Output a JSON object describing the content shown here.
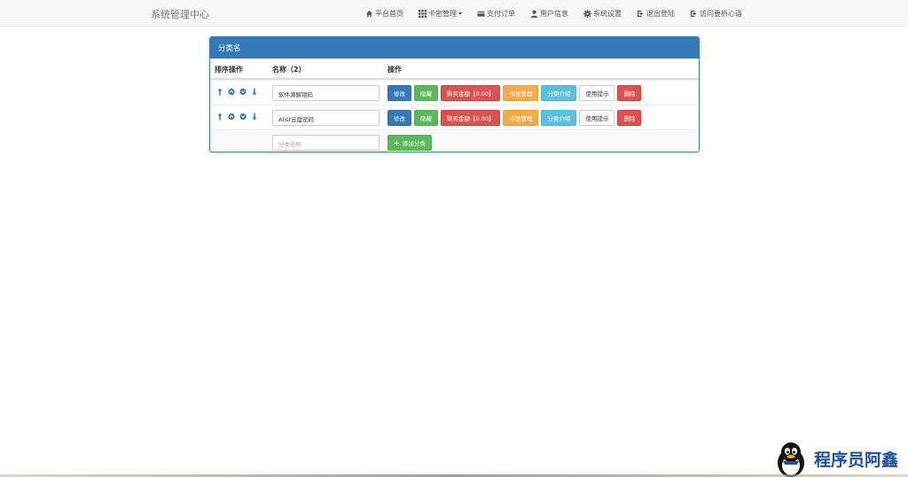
{
  "navbar": {
    "brand": "系统管理中心",
    "items": [
      {
        "label": "平台首页",
        "icon": "home-icon"
      },
      {
        "label": "卡密管理",
        "icon": "grid-icon",
        "dropdown": true
      },
      {
        "label": "支付订单",
        "icon": "card-icon"
      },
      {
        "label": "用户信息",
        "icon": "user-icon"
      },
      {
        "label": "系统设置",
        "icon": "gear-icon"
      },
      {
        "label": "退出登陆",
        "icon": "logout-icon"
      },
      {
        "label": "访问要析心语",
        "icon": "logout-icon"
      }
    ]
  },
  "panel": {
    "title": "分类名",
    "headers": {
      "sort": "排序操作",
      "name": "名称（2）",
      "actions": "操作"
    },
    "rows": [
      {
        "name": "软件源解锁码"
      },
      {
        "name": "Alist云盘密码"
      }
    ],
    "buttons": {
      "edit": "修改",
      "hide": "隐藏",
      "price": "购买金额【0.00】",
      "cards": "卡密管理",
      "intro": "分类介绍",
      "tips": "使用提示",
      "delete": "删除"
    },
    "new_row": {
      "placeholder": "分类名称",
      "add_label": "添加分类"
    }
  },
  "watermark": {
    "text": "程序员阿鑫"
  },
  "colors": {
    "primary": "#337ab7",
    "success": "#5cb85c",
    "danger": "#d9534f",
    "warning": "#f0ad4e",
    "info": "#5bc0de"
  }
}
